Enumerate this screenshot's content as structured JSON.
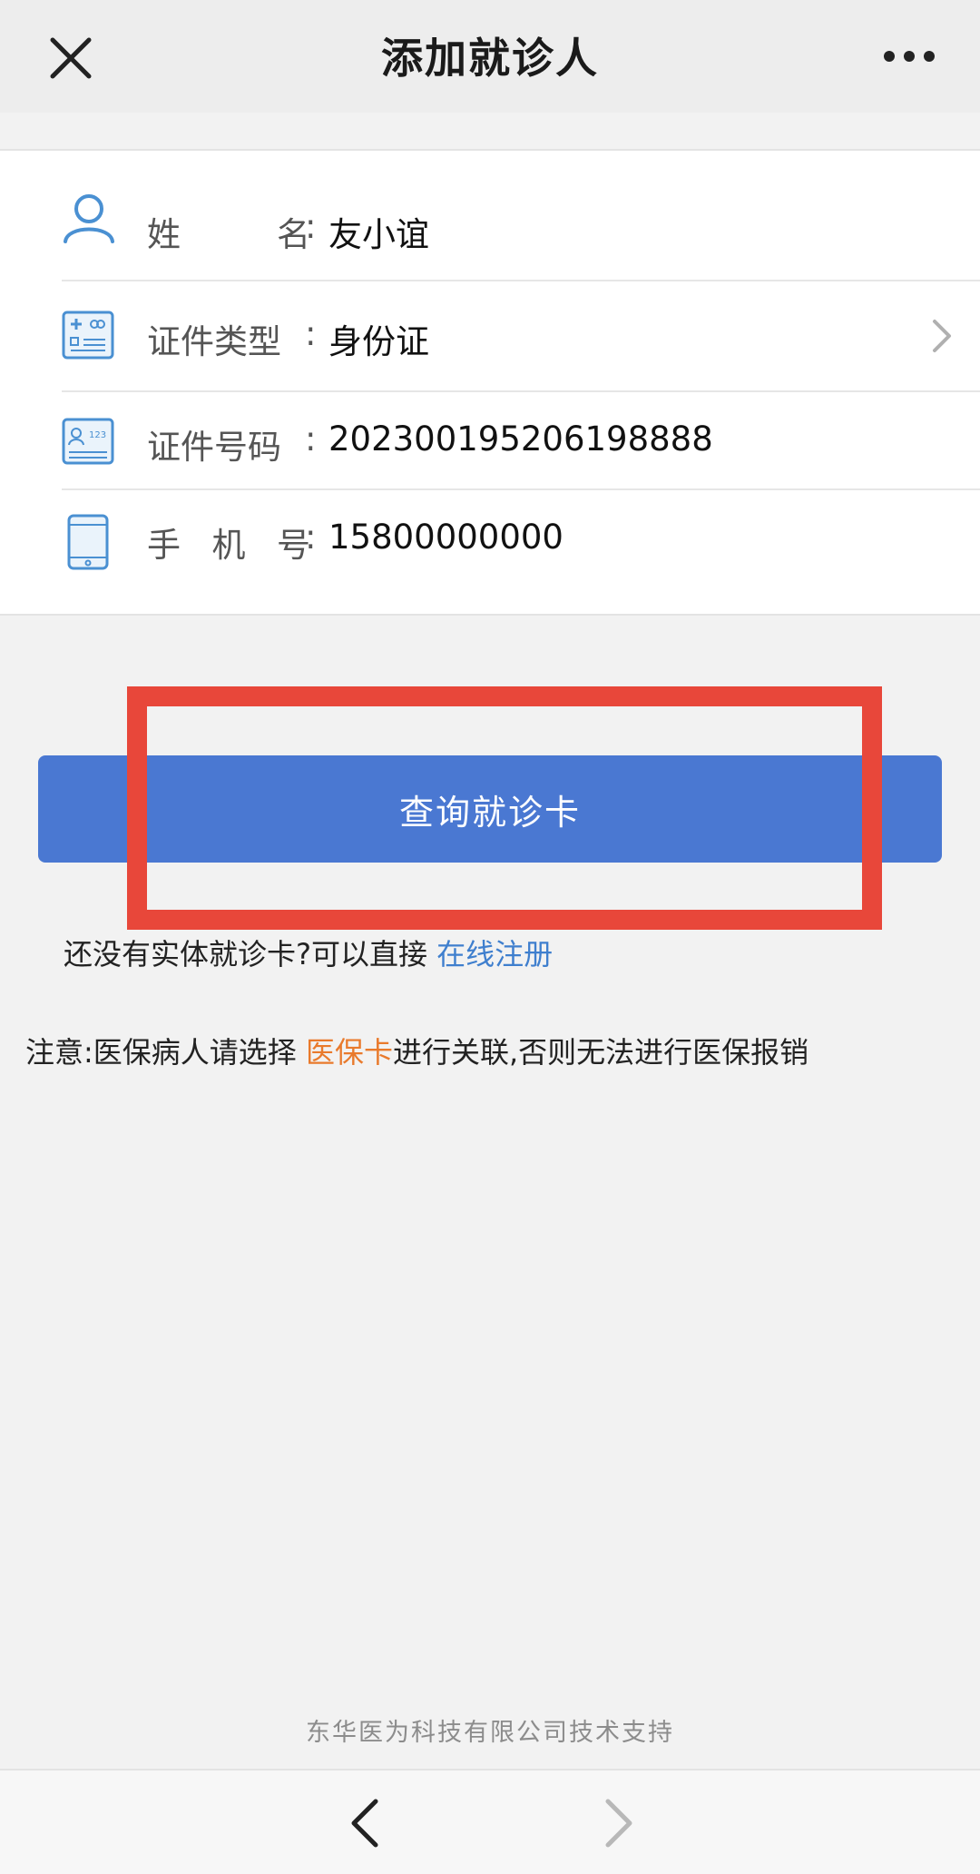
{
  "header": {
    "title": "添加就诊人",
    "close_icon": "close-icon",
    "more_icon": "more-dots-icon"
  },
  "form": {
    "name": {
      "label_chars": [
        "姓",
        "名"
      ],
      "colon": ":",
      "value": "友小谊",
      "icon": "person-icon"
    },
    "id_type": {
      "label": "证件类型",
      "colon": ":",
      "value": "身份证",
      "icon": "id-type-card-icon",
      "chevron": "chevron-right-icon"
    },
    "id_number": {
      "label": "证件号码",
      "colon": ":",
      "value": "202300195206198888",
      "icon": "id-number-card-icon"
    },
    "phone": {
      "label_chars": [
        "手",
        "机",
        "号"
      ],
      "colon": ":",
      "value": "15800000000",
      "icon": "mobile-phone-icon"
    }
  },
  "actions": {
    "query_button": "查询就诊卡"
  },
  "register": {
    "prefix": "还没有实体就诊卡?可以直接 ",
    "link": "在线注册"
  },
  "notice": {
    "prefix": "注意:医保病人请选择 ",
    "highlight": "医保卡",
    "suffix": "进行关联,否则无法进行医保报销"
  },
  "footer": {
    "credit": "东华医为科技有限公司技术支持"
  },
  "colors": {
    "primary_button": "#4a78d2",
    "link": "#3f7fce",
    "highlight": "#e97a2c",
    "annotation_box": "#e8473a"
  }
}
